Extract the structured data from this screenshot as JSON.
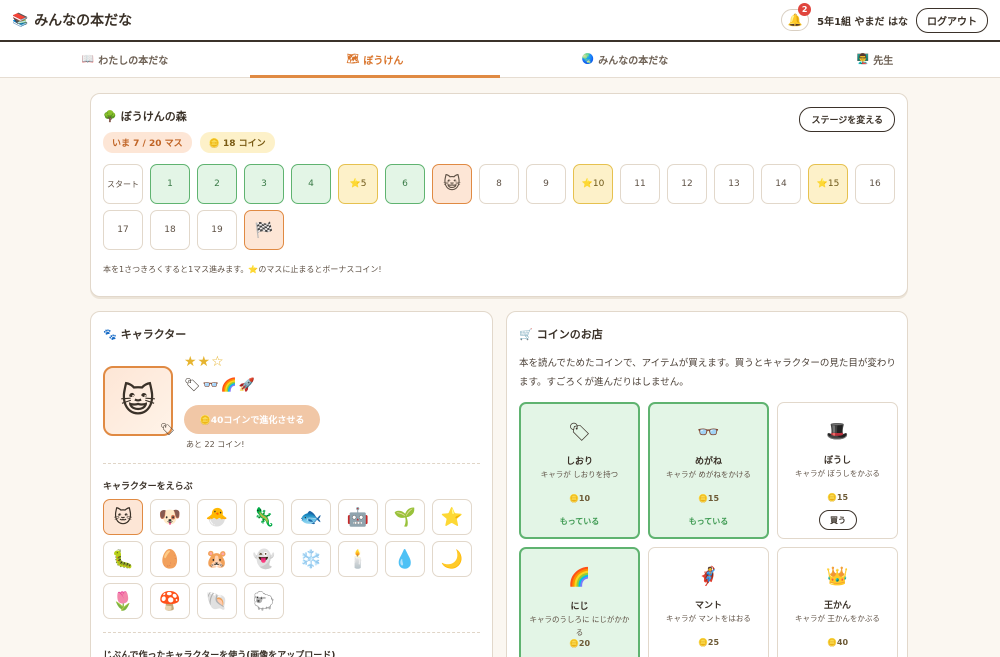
{
  "header": {
    "logo_icon": "📚",
    "title": "みんなの本だな",
    "bell_icon": "🔔",
    "notification_count": "2",
    "user": "5年1組 やまだ はな",
    "logout_label": "ログアウト"
  },
  "tabs": [
    {
      "icon": "📖",
      "label": "わたしの本だな"
    },
    {
      "icon": "🗺",
      "label": "ぼうけん"
    },
    {
      "icon": "🌏",
      "label": "みんなの本だな"
    },
    {
      "icon": "👨‍🏫",
      "label": "先生"
    }
  ],
  "adventure": {
    "icon": "🌳",
    "title": "ぼうけんの森",
    "change_stage_label": "ステージを変える",
    "position_label": "いま 7 / 20 マス",
    "coin_icon": "🪙",
    "coin_label": "18 コイン",
    "start_label": "スタート",
    "cells": [
      {
        "label": "1",
        "state": "visited"
      },
      {
        "label": "2",
        "state": "visited"
      },
      {
        "label": "3",
        "state": "visited"
      },
      {
        "label": "4",
        "state": "visited"
      },
      {
        "label": "⭐5",
        "state": "bonus"
      },
      {
        "label": "6",
        "state": "visited"
      },
      {
        "label": "😺",
        "state": "current"
      },
      {
        "label": "8",
        "state": ""
      },
      {
        "label": "9",
        "state": ""
      },
      {
        "label": "⭐10",
        "state": "bonus"
      },
      {
        "label": "11",
        "state": ""
      },
      {
        "label": "12",
        "state": ""
      },
      {
        "label": "13",
        "state": ""
      },
      {
        "label": "14",
        "state": ""
      },
      {
        "label": "⭐15",
        "state": "bonus"
      },
      {
        "label": "16",
        "state": ""
      },
      {
        "label": "17",
        "state": ""
      },
      {
        "label": "18",
        "state": ""
      },
      {
        "label": "19",
        "state": ""
      },
      {
        "label": "🏁",
        "state": "goal"
      }
    ],
    "note": "本を1さつきろくすると1マス進みます。⭐のマスに止まるとボーナスコイン!"
  },
  "character": {
    "icon": "🐾",
    "title": "キャラクター",
    "avatar": "😺",
    "avatar_tag": "🏷",
    "stars": "★★☆",
    "items": "🏷👓🌈🚀",
    "evolve_label": "🪙40コインで進化させる",
    "remaining": "あと 22 コイン!",
    "choose_label": "キャラクターをえらぶ",
    "choices": [
      "🐱",
      "🐶",
      "🐣",
      "🦎",
      "🐟",
      "🤖",
      "🌱",
      "⭐",
      "🐛",
      "🥚",
      "🐹",
      "👻",
      "❄️",
      "🕯️",
      "💧",
      "🌙",
      "🌷",
      "🍄",
      "🐚",
      "🐑"
    ],
    "upload_label": "じぶんで作ったキャラクターを使う(画像をアップロード)"
  },
  "shop": {
    "icon": "🛒",
    "title": "コインのお店",
    "description": "本を読んでためたコインで、アイテムが買えます。買うとキャラクターの見た目が変わります。すごろくが進んだりはしません。",
    "items": [
      {
        "icon": "🏷",
        "name": "しおり",
        "desc": "キャラが しおりを持つ",
        "price": "🪙10",
        "status": "もっている",
        "owned": true
      },
      {
        "icon": "👓",
        "name": "めがね",
        "desc": "キャラが めがねをかける",
        "price": "🪙15",
        "status": "もっている",
        "owned": true
      },
      {
        "icon": "🎩",
        "name": "ぼうし",
        "desc": "キャラが ぼうしをかぶる",
        "price": "🪙15",
        "status": "買う",
        "owned": false
      },
      {
        "icon": "🌈",
        "name": "にじ",
        "desc": "キャラのうしろに にじがかかる",
        "price": "🪙20",
        "status": "",
        "owned": true
      },
      {
        "icon": "🦸",
        "name": "マント",
        "desc": "キャラが マントをはおる",
        "price": "🪙25",
        "status": "",
        "owned": false
      },
      {
        "icon": "👑",
        "name": "王かん",
        "desc": "キャラが 王かんをかぶる",
        "price": "🪙40",
        "status": "",
        "owned": false
      }
    ]
  }
}
